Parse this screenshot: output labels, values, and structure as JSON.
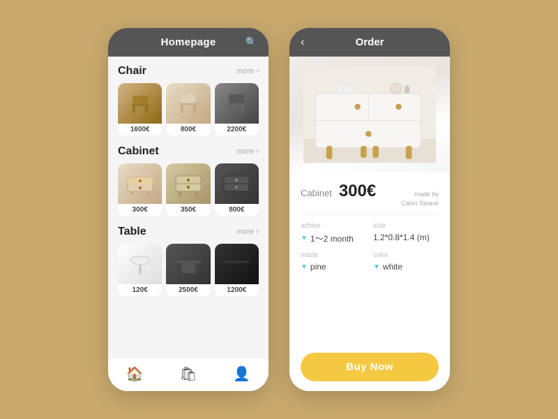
{
  "left_phone": {
    "header": {
      "title": "Homepage",
      "search_label": "🔍"
    },
    "sections": [
      {
        "id": "chair",
        "title": "Chair",
        "more_label": "more",
        "products": [
          {
            "id": "chair1",
            "price": "1600€",
            "img_class": "img-chair1",
            "emoji": "🪑"
          },
          {
            "id": "chair2",
            "price": "800€",
            "img_class": "img-chair2",
            "emoji": "🪑"
          },
          {
            "id": "chair3",
            "price": "2200€",
            "img_class": "img-chair3",
            "emoji": "🪑"
          }
        ]
      },
      {
        "id": "cabinet",
        "title": "Cabinet",
        "more_label": "more",
        "products": [
          {
            "id": "cab1",
            "price": "300€",
            "img_class": "img-cabinet1",
            "emoji": "🗄️"
          },
          {
            "id": "cab2",
            "price": "350€",
            "img_class": "img-cabinet2",
            "emoji": "🗄️"
          },
          {
            "id": "cab3",
            "price": "800€",
            "img_class": "img-cabinet3",
            "emoji": "🗄️"
          }
        ]
      },
      {
        "id": "table",
        "title": "Table",
        "more_label": "more",
        "products": [
          {
            "id": "tbl1",
            "price": "120€",
            "img_class": "img-table1",
            "emoji": "🪵"
          },
          {
            "id": "tbl2",
            "price": "2500€",
            "img_class": "img-table2",
            "emoji": "🪵"
          },
          {
            "id": "tbl3",
            "price": "1200€",
            "img_class": "img-table3",
            "emoji": "🪵"
          }
        ]
      }
    ],
    "nav": [
      {
        "id": "home",
        "icon": "🏠",
        "active": true
      },
      {
        "id": "cart",
        "icon": "🛍",
        "active": false
      },
      {
        "id": "profile",
        "icon": "👤",
        "active": false
      }
    ]
  },
  "right_phone": {
    "header": {
      "title": "Order",
      "back_label": "‹"
    },
    "product": {
      "category": "Cabinet",
      "price": "300€",
      "maker_line1": "made by",
      "maker_line2": "Calon Steave"
    },
    "specs": [
      {
        "id": "achive",
        "label": "achive",
        "value": "1～2 month",
        "has_arrow": true
      },
      {
        "id": "size",
        "label": "size",
        "value": "1.2*0.8*1.4  (m)",
        "has_arrow": false
      },
      {
        "id": "made",
        "label": "made",
        "value": "pine",
        "has_arrow": true
      },
      {
        "id": "color",
        "label": "color",
        "value": "white",
        "has_arrow": true
      }
    ],
    "buy_button": "Buy Now"
  }
}
